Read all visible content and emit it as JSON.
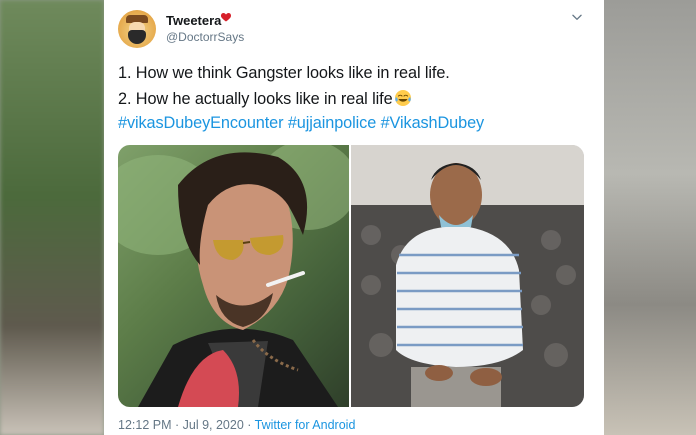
{
  "tweet": {
    "user_name": "Tweetera",
    "user_handle": "@DoctorrSays",
    "line1": "1. How we think Gangster looks like in real life.",
    "line2": "2. How he actually looks like in real life",
    "hashtags": "#vikasDubeyEncounter #ujjainpolice #VikashDubey",
    "time": "12:12 PM · Jul 9, 2020 · ",
    "source": "Twitter for Android"
  },
  "icons": {
    "heart": "heart-icon",
    "chevron": "chevron-down-icon",
    "emoji": "tears-of-joy-emoji"
  },
  "colors": {
    "link": "#1b95e0",
    "secondary_text": "#657786",
    "primary_text": "#14171a",
    "heart": "#d6202a"
  }
}
